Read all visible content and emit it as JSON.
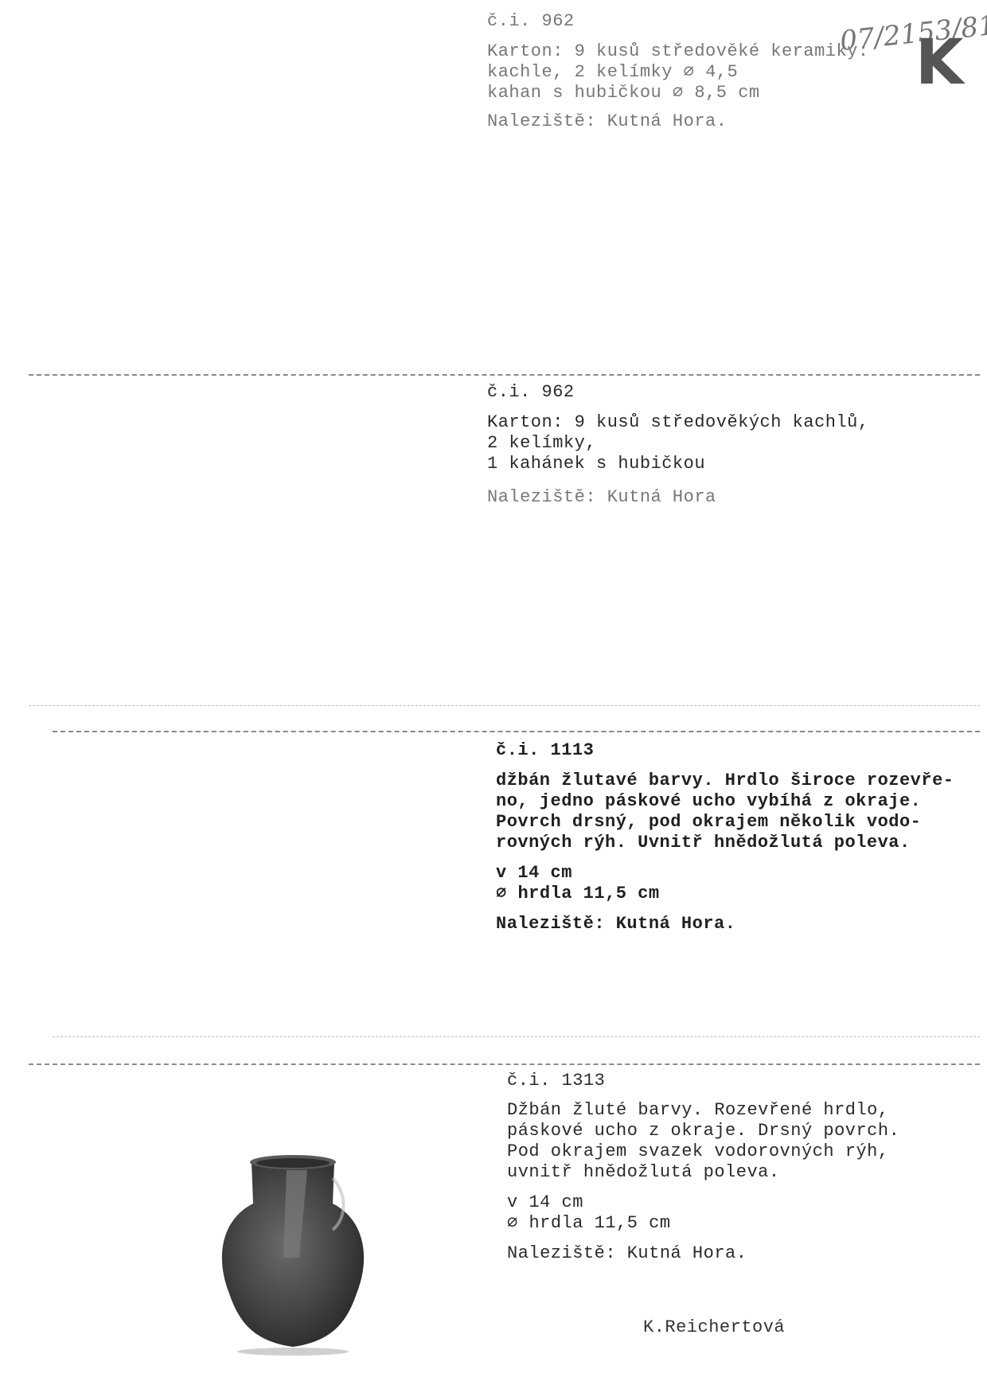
{
  "header": {
    "handwritten_number": "07/2153/81",
    "stamp_letter": "K"
  },
  "cards": [
    {
      "id": "č.i. 962",
      "lines": [
        "Karton: 9 kusů středověké keramiky:",
        "kachle, 2 kelímky ⌀ 4,5",
        "kahan s hubičkou ⌀ 8,5 cm"
      ],
      "site": "Naleziště: Kutná Hora."
    },
    {
      "id": "č.i. 962",
      "lines": [
        "Karton: 9 kusů středověkých kachlů,",
        "2 kelímky,",
        "1 kahánek s hubičkou"
      ],
      "site": "Naleziště: Kutná Hora"
    },
    {
      "id": "č.i. 1113",
      "lines": [
        "džbán žlutavé barvy. Hrdlo široce rozevře-",
        "no, jedno páskové ucho vybíhá z okraje.",
        "Povrch drsný, pod okrajem několik vodo-",
        "rovných rýh. Uvnitř hnědožlutá poleva."
      ],
      "measures": [
        "v 14 cm",
        "⌀ hrdla 11,5 cm"
      ],
      "site": "Naleziště: Kutná Hora."
    },
    {
      "id": "č.i. 1313",
      "lines": [
        "Džbán žluté barvy. Rozevřené hrdlo,",
        "páskové ucho z okraje. Drsný povrch.",
        "Pod okrajem svazek vodorovných rýh,",
        "uvnitř hnědožlutá poleva."
      ],
      "measures": [
        "v 14 cm",
        "⌀ hrdla 11,5 cm"
      ],
      "site": "Naleziště: Kutná Hora."
    }
  ],
  "signature": "K.Reichertová",
  "colors": {
    "ink": "#2a2a2a",
    "faded_ink": "#777777",
    "rule": "#8a8a8a",
    "photo_dark": "#3a3a3a"
  }
}
